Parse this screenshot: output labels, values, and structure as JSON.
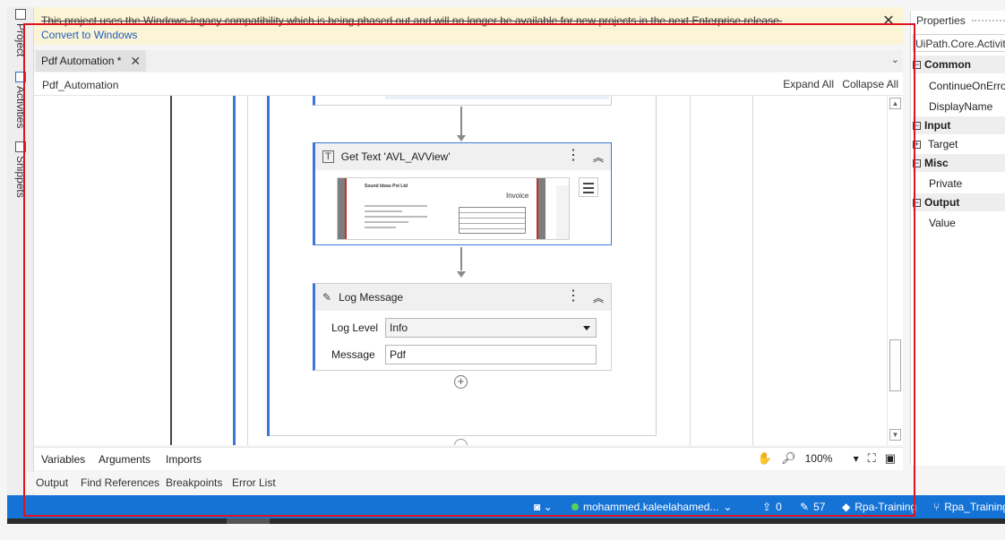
{
  "side_tabs": [
    {
      "label": "Project",
      "icon": "project-icon"
    },
    {
      "label": "Activities",
      "icon": "activities-icon"
    },
    {
      "label": "Snippets",
      "icon": "snippets-icon"
    }
  ],
  "banner": {
    "message": "This project uses the Windows-legacy compatibility which is being phased out and will no longer be available for new projects in the next Enterprise release.",
    "link": "Convert to Windows",
    "close": "✕"
  },
  "tabs": {
    "doc_tab": "Pdf Automation *",
    "close": "✕",
    "overflow": "⌄"
  },
  "designer": {
    "breadcrumb": "Pdf_Automation",
    "expand_all": "Expand All",
    "collapse_all": "Collapse All"
  },
  "activities": {
    "get_text": {
      "title": "Get Text 'AVL_AVView'",
      "menu": "⋮",
      "collapse": "︽",
      "preview": {
        "doc_title": "Sound Ideas Pvt Ltd",
        "doc_heading": "Invoice"
      }
    },
    "log_message": {
      "title": "Log Message",
      "menu": "⋮",
      "collapse": "︽",
      "log_level_label": "Log Level",
      "log_level_value": "Info",
      "message_label": "Message",
      "message_value": "Pdf"
    },
    "add": "+"
  },
  "bottom_tabs": {
    "variables": "Variables",
    "arguments": "Arguments",
    "imports": "Imports",
    "zoom": "100%",
    "zoom_caret": "▾"
  },
  "panel_tabs": [
    "Output",
    "Find References",
    "Breakpoints",
    "Error List"
  ],
  "status_bar": {
    "user": "mohammed.kaleelahamed...",
    "publish_count": "0",
    "changes_count": "57",
    "project": "Rpa-Training",
    "branch": "Rpa_Training"
  },
  "properties": {
    "title": "Properties",
    "type": "UiPath.Core.Activities",
    "categories": [
      {
        "name": "Common",
        "items": [
          "ContinueOnError",
          "DisplayName"
        ]
      },
      {
        "name": "Input",
        "items": [
          "Target"
        ]
      },
      {
        "name": "Misc",
        "items": [
          "Private"
        ]
      },
      {
        "name": "Output",
        "items": [
          "Value"
        ]
      }
    ]
  },
  "colors": {
    "accent": "#1673d6",
    "banner_bg": "#fcf4d6",
    "selection": "#e0141e",
    "activity_border": "#3b78d6"
  }
}
